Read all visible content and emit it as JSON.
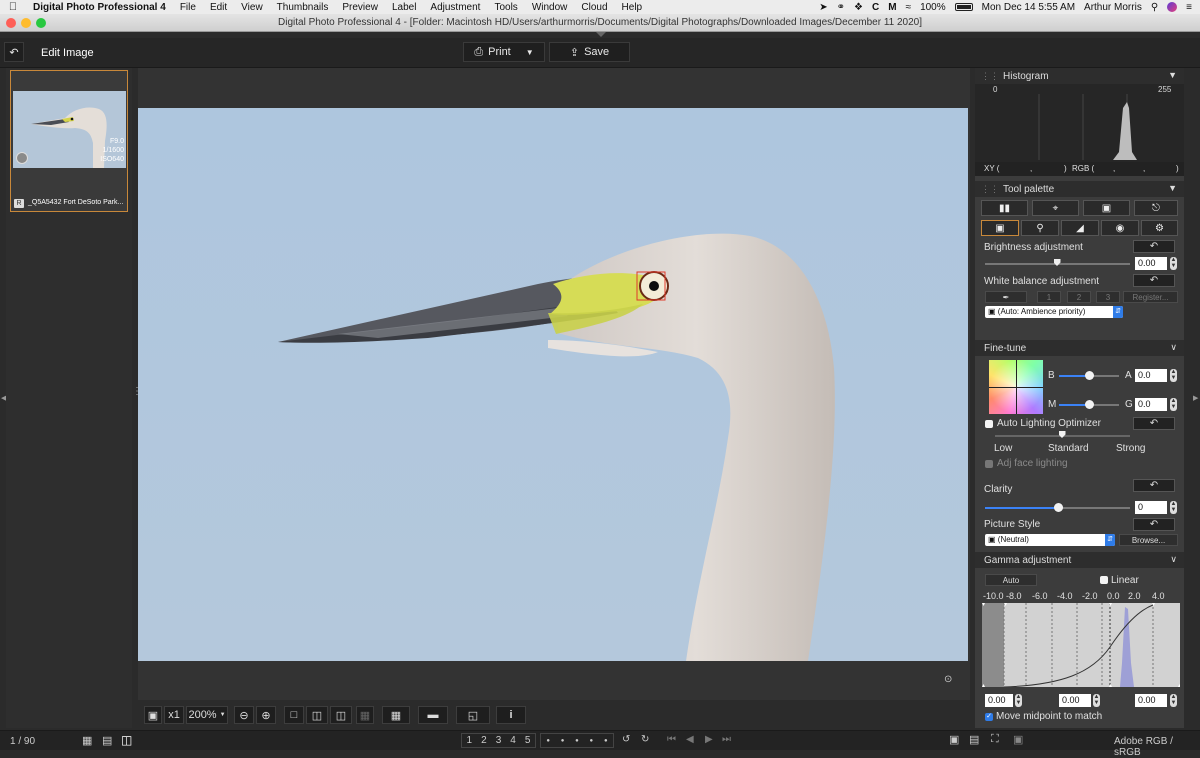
{
  "menubar": {
    "app_name": "Digital Photo Professional 4",
    "menus": [
      "File",
      "Edit",
      "View",
      "Thumbnails",
      "Preview",
      "Label",
      "Adjustment",
      "Tools",
      "Window",
      "Cloud",
      "Help"
    ],
    "battery": "100%",
    "datetime": "Mon Dec 14  5:55 AM",
    "user": "Arthur Morris",
    "status_icons": [
      "location-icon",
      "creative-cloud-icon",
      "dropbox-icon",
      "c-icon",
      "m-icon",
      "wifi-icon",
      "battery-icon",
      "search-icon",
      "siri-icon",
      "list-icon"
    ]
  },
  "window": {
    "title": "Digital Photo Professional 4 - [Folder: Macintosh HD/Users/arthurmorris/Documents/Digital Photographs/Downloaded Images/December 11 2020]"
  },
  "toolbar": {
    "back_icon": "return-icon",
    "mode_label": "Edit Image",
    "print_label": "Print",
    "save_label": "Save"
  },
  "thumbnail": {
    "aperture": "F9.0",
    "shutter": "1/1600",
    "iso": "ISO640",
    "raw_badge": "R",
    "filename": "_Q5A5432 Fort DeSoto Park..."
  },
  "zoom": {
    "fit_icon": "fit-screen-icon",
    "x1_label": "x1",
    "level": "200%"
  },
  "status": {
    "count": "1 / 90",
    "color_space": "Adobe RGB / sRGB",
    "ratings": [
      "1",
      "2",
      "3",
      "4",
      "5"
    ]
  },
  "panels": {
    "histogram": {
      "title": "Histogram",
      "min": "0",
      "max": "255",
      "xy_label": "XY (",
      "xy_sep": ",",
      "xy_end": ")",
      "rgb_label": "RGB (",
      "rgb_sep1": ",",
      "rgb_sep2": ",",
      "rgb_end": ")"
    },
    "tool_palette": {
      "title": "Tool palette",
      "brightness_label": "Brightness adjustment",
      "brightness_value": "0.00",
      "brightness_level": 0.5,
      "wb_label": "White balance adjustment",
      "wb_buttons": [
        "1",
        "2",
        "3"
      ],
      "register_label": "Register...",
      "wb_select": "(Auto: Ambience priority)"
    },
    "fine_tune": {
      "title": "Fine-tune",
      "b_label": "B",
      "a_label": "A",
      "ba_value": "0.0",
      "m_label": "M",
      "g_label": "G",
      "mg_value": "0.0",
      "alo_label": "Auto Lighting Optimizer",
      "alo_low": "Low",
      "alo_standard": "Standard",
      "alo_strong": "Strong",
      "adj_face_label": "Adj face lighting",
      "clarity_label": "Clarity",
      "clarity_value": "0",
      "clarity_level": 0.5,
      "picture_style_label": "Picture Style",
      "picture_style_value": "(Neutral)",
      "browse_label": "Browse..."
    },
    "gamma": {
      "title": "Gamma adjustment",
      "auto_label": "Auto",
      "linear_label": "Linear",
      "scale": [
        "-10.0",
        "-8.0",
        "-6.0",
        "-4.0",
        "-2.0",
        "0.0",
        "2.0",
        "4.0"
      ],
      "left_value": "0.00",
      "mid_value": "0.00",
      "right_value": "0.00",
      "midpoint_label": "Move midpoint to match"
    }
  }
}
